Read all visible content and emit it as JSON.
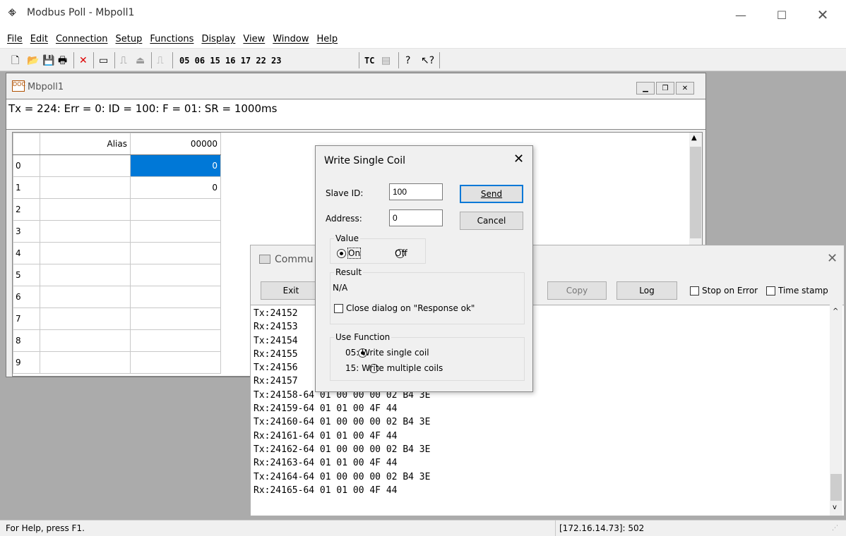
{
  "app": {
    "title": "Modbus Poll - Mbpoll1"
  },
  "menu": [
    "File",
    "Edit",
    "Connection",
    "Setup",
    "Functions",
    "Display",
    "View",
    "Window",
    "Help"
  ],
  "toolbar": {
    "function_codes": "05 06 15 16 17 22 23",
    "tc": "TC"
  },
  "child": {
    "title": "Mbpoll1",
    "summary": "Tx = 224: Err = 0: ID = 100: F = 01: SR = 1000ms"
  },
  "grid": {
    "alias_header": "Alias",
    "col_header": "00000",
    "rows": [
      {
        "n": "0",
        "v": "0"
      },
      {
        "n": "1",
        "v": "0"
      },
      {
        "n": "2",
        "v": ""
      },
      {
        "n": "3",
        "v": ""
      },
      {
        "n": "4",
        "v": ""
      },
      {
        "n": "5",
        "v": ""
      },
      {
        "n": "6",
        "v": ""
      },
      {
        "n": "7",
        "v": ""
      },
      {
        "n": "8",
        "v": ""
      },
      {
        "n": "9",
        "v": ""
      }
    ]
  },
  "comm": {
    "title": "Commu",
    "exit": "Exit",
    "copy": "Copy",
    "log": "Log",
    "stop_on_error": "Stop on Error",
    "time_stamp": "Time stamp",
    "lines": [
      "Tx:24152",
      "Rx:24153",
      "Tx:24154",
      "Rx:24155",
      "Tx:24156",
      "Rx:24157",
      "Tx:24158-64 01 00 00 00 02 B4 3E",
      "Rx:24159-64 01 01 00 4F 44",
      "Tx:24160-64 01 00 00 00 02 B4 3E",
      "Rx:24161-64 01 01 00 4F 44",
      "Tx:24162-64 01 00 00 00 02 B4 3E",
      "Rx:24163-64 01 01 00 4F 44",
      "Tx:24164-64 01 00 00 00 02 B4 3E",
      "Rx:24165-64 01 01 00 4F 44"
    ]
  },
  "dialog": {
    "title": "Write Single Coil",
    "slave_label": "Slave ID:",
    "slave_value": "100",
    "addr_label": "Address:",
    "addr_value": "0",
    "send": "Send",
    "cancel": "Cancel",
    "value_group": "Value",
    "on": "On",
    "off": "Off",
    "result_group": "Result",
    "result": "N/A",
    "close_on_ok": "Close dialog on \"Response ok\"",
    "func_group": "Use Function",
    "f05": "05: Write single coil",
    "f15": "15: Write multiple coils"
  },
  "status": {
    "help": "For Help, press F1.",
    "conn": "[172.16.14.73]: 502"
  }
}
